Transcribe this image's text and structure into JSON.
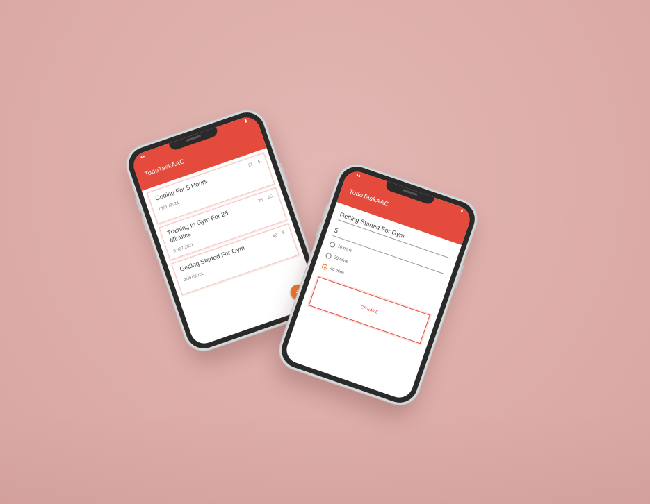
{
  "app": {
    "title": "TodoTaskAAC",
    "accent_color": "#e44b3c",
    "fab_color": "#f0782e"
  },
  "list_screen": {
    "tasks": [
      {
        "title": "Coding For 5 Hours",
        "date": "01/07/2021",
        "value_a": "21",
        "value_b": "5"
      },
      {
        "title": "Training In Gym For 25 Minutes",
        "date": "01/07/2021",
        "value_a": "25",
        "value_b": "25"
      },
      {
        "title": "Getting Started For Gym",
        "date": "01/07/2021",
        "value_a": "40",
        "value_b": "5"
      }
    ],
    "fab_icon": "plus-icon",
    "fab_label": "+"
  },
  "form_screen": {
    "name_value": "Getting Started For Gym",
    "number_value": "5",
    "options": [
      {
        "label": "10 mins",
        "checked": false
      },
      {
        "label": "25 mins",
        "checked": false
      },
      {
        "label": "40 mins",
        "checked": true
      }
    ],
    "create_label": "CREATE"
  }
}
